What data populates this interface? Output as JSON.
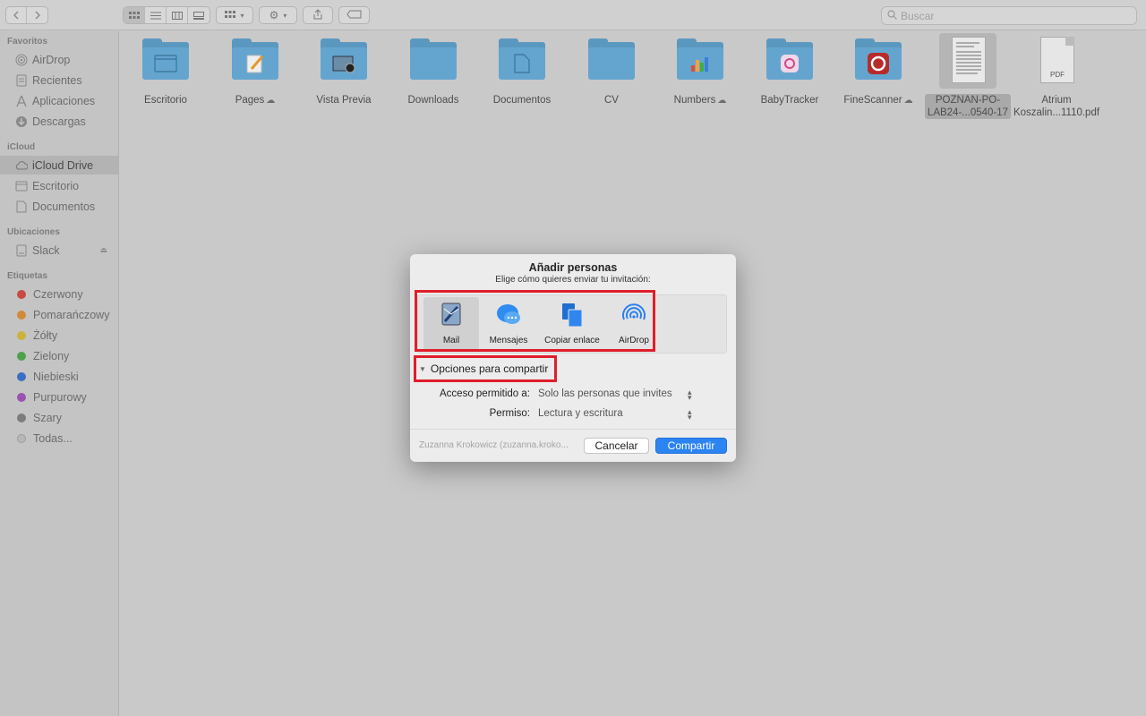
{
  "toolbar": {
    "back_icon": "chevron-left",
    "forward_icon": "chevron-right",
    "view_modes": [
      "icons",
      "list",
      "columns",
      "gallery"
    ],
    "group_icon": "grid-group",
    "action_icon": "gear",
    "share_icon": "share",
    "tag_icon": "tag",
    "search_placeholder": "Buscar"
  },
  "sidebar": {
    "sections": [
      {
        "title": "Favoritos",
        "items": [
          {
            "label": "AirDrop",
            "icon": "airdrop-icon"
          },
          {
            "label": "Recientes",
            "icon": "clock-icon"
          },
          {
            "label": "Aplicaciones",
            "icon": "apps-icon"
          },
          {
            "label": "Descargas",
            "icon": "download-icon"
          }
        ]
      },
      {
        "title": "iCloud",
        "items": [
          {
            "label": "iCloud Drive",
            "icon": "cloud-icon",
            "selected": true
          },
          {
            "label": "Escritorio",
            "icon": "desktop-icon"
          },
          {
            "label": "Documentos",
            "icon": "document-icon"
          }
        ]
      },
      {
        "title": "Ubicaciones",
        "items": [
          {
            "label": "Slack",
            "icon": "disk-icon",
            "eject": true
          }
        ]
      },
      {
        "title": "Etiquetas",
        "items": [
          {
            "label": "Czerwony",
            "color": "#c94a42"
          },
          {
            "label": "Pomarańczowy",
            "color": "#d18a3a"
          },
          {
            "label": "Żółty",
            "color": "#cbb23d"
          },
          {
            "label": "Zielony",
            "color": "#4ea24e"
          },
          {
            "label": "Niebieski",
            "color": "#3b6fc4"
          },
          {
            "label": "Purpurowy",
            "color": "#9a52b0"
          },
          {
            "label": "Szary",
            "color": "#7c7c7c"
          },
          {
            "label": "Todas...",
            "color": "#b7b7b7"
          }
        ]
      }
    ]
  },
  "files": [
    {
      "name": "Escritorio",
      "type": "folder",
      "cloud": false
    },
    {
      "name": "Pages",
      "type": "folder",
      "cloud": true
    },
    {
      "name": "Vista Previa",
      "type": "folder",
      "cloud": false
    },
    {
      "name": "Downloads",
      "type": "folder",
      "cloud": false
    },
    {
      "name": "Documentos",
      "type": "folder",
      "cloud": false
    },
    {
      "name": "CV",
      "type": "folder",
      "cloud": false
    },
    {
      "name": "Numbers",
      "type": "folder",
      "cloud": true
    },
    {
      "name": "BabyTracker",
      "type": "folder",
      "cloud": false
    },
    {
      "name": "FineScanner",
      "type": "folder",
      "cloud": true
    },
    {
      "name": "POZNAN-PO-\nLAB24-...0540-17",
      "type": "document",
      "selected": true
    },
    {
      "name": "Atrium\nKoszalin...1110.pdf",
      "type": "pdf",
      "badge": "PDF"
    }
  ],
  "dialog": {
    "title": "Añadir personas",
    "subtitle": "Elige cómo quieres enviar tu invitación:",
    "share_options": [
      {
        "label": "Mail",
        "icon": "mail-icon",
        "selected": true
      },
      {
        "label": "Mensajes",
        "icon": "messages-icon"
      },
      {
        "label": "Copiar enlace",
        "icon": "copy-link-icon"
      },
      {
        "label": "AirDrop",
        "icon": "airdrop-icon"
      }
    ],
    "options_toggle": "Opciones para compartir",
    "access_label": "Acceso permitido a:",
    "access_value": "Solo las personas que invites",
    "permission_label": "Permiso:",
    "permission_value": "Lectura y escritura",
    "owner": "Zuzanna Krokowicz (zuzanna.kroko...",
    "cancel": "Cancelar",
    "share": "Compartir"
  },
  "colors": {
    "highlight": "#e01e2b",
    "primary_button": "#2c84f2",
    "folder": "#64a5cf"
  }
}
